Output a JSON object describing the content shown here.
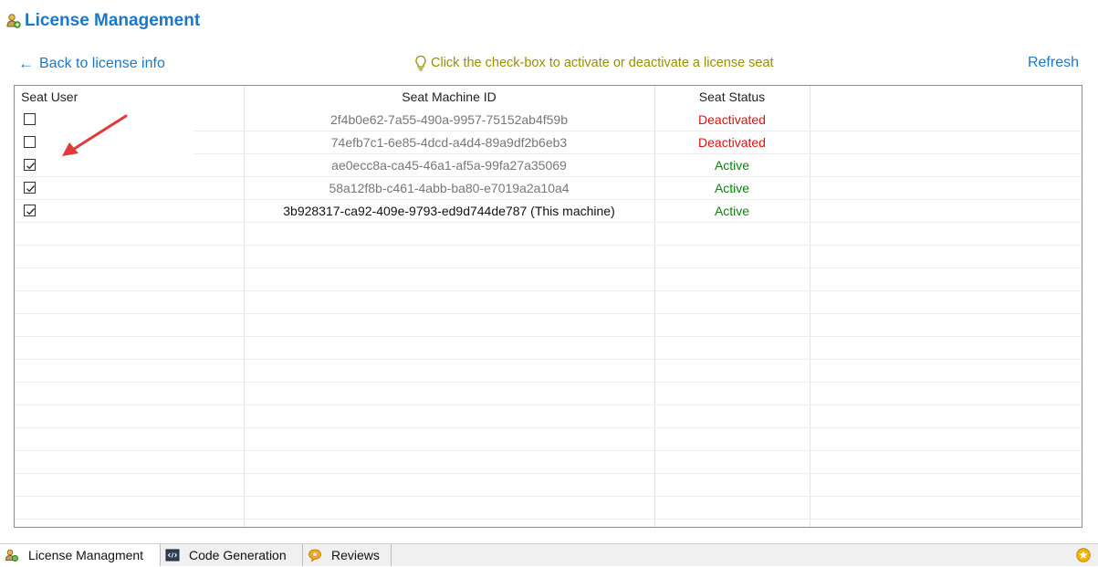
{
  "page": {
    "title": "License Management"
  },
  "toolbar": {
    "back_label": "Back to license info",
    "back_arrow": "←",
    "hint": "Click the check-box to activate or deactivate a license seat",
    "refresh_label": "Refresh"
  },
  "grid": {
    "columns": [
      "Seat User",
      "Seat Machine ID",
      "Seat Status"
    ],
    "rows": [
      {
        "checked": false,
        "machine_id": "2f4b0e62-7a55-490a-9957-75152ab4f59b",
        "status": "Deactivated",
        "this_machine": false
      },
      {
        "checked": false,
        "machine_id": "74efb7c1-6e85-4dcd-a4d4-89a9df2b6eb3",
        "status": "Deactivated",
        "this_machine": false
      },
      {
        "checked": true,
        "machine_id": "ae0ecc8a-ca45-46a1-af5a-99fa27a35069",
        "status": "Active",
        "this_machine": false
      },
      {
        "checked": true,
        "machine_id": "58a12f8b-c461-4abb-ba80-e7019a2a10a4",
        "status": "Active",
        "this_machine": false
      },
      {
        "checked": true,
        "machine_id": "3b928317-ca92-409e-9793-ed9d744de787 (This machine)",
        "status": "Active",
        "this_machine": true
      }
    ]
  },
  "tabs": [
    {
      "label": "License Managment",
      "icon": "key-user-icon",
      "active": true
    },
    {
      "label": "Code Generation",
      "icon": "code-window-icon",
      "active": false
    },
    {
      "label": "Reviews",
      "icon": "chat-bubble-icon",
      "active": false
    }
  ],
  "colors": {
    "accent": "#1a78c8",
    "hint": "#9a8f00",
    "deactivated": "#e01010",
    "active": "#108010",
    "annotation_arrow": "#e03a3a"
  }
}
